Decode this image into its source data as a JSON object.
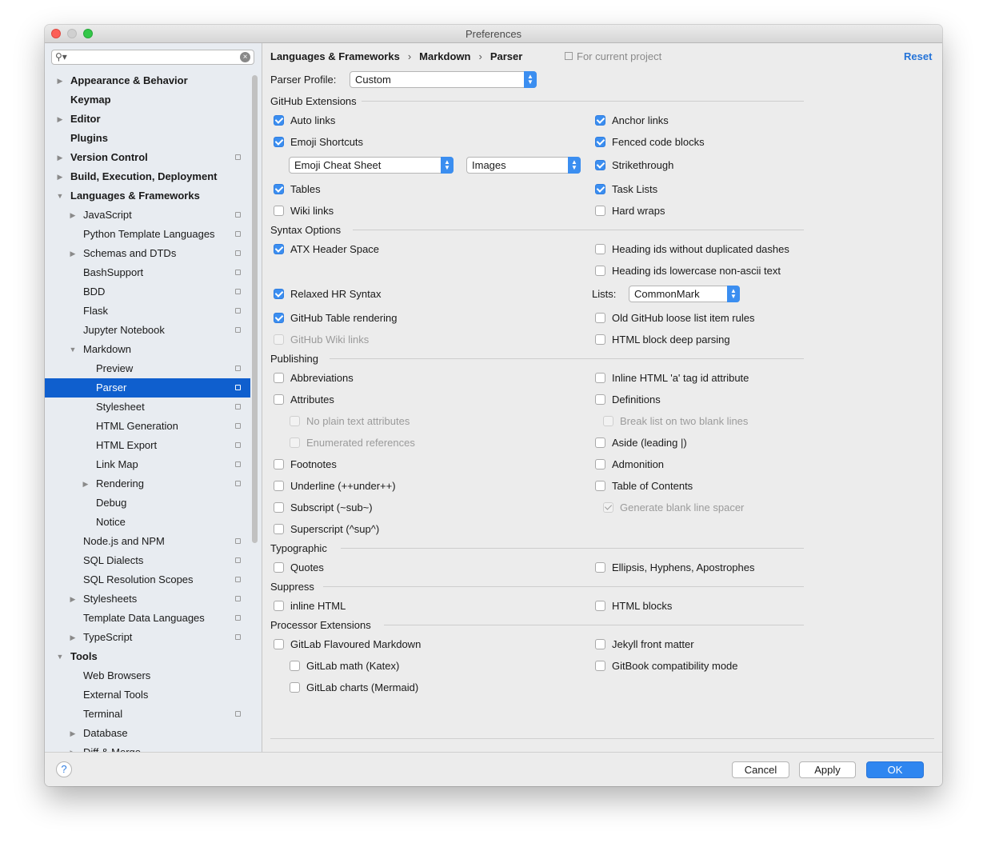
{
  "window": {
    "title": "Preferences"
  },
  "search": {
    "placeholder": ""
  },
  "sidebar": {
    "items": [
      {
        "label": "Appearance & Behavior",
        "level": 0,
        "bold": true,
        "arrow": "right",
        "copy": false
      },
      {
        "label": "Keymap",
        "level": 0,
        "bold": true,
        "arrow": "",
        "copy": false
      },
      {
        "label": "Editor",
        "level": 0,
        "bold": true,
        "arrow": "right",
        "copy": false
      },
      {
        "label": "Plugins",
        "level": 0,
        "bold": true,
        "arrow": "",
        "copy": false
      },
      {
        "label": "Version Control",
        "level": 0,
        "bold": true,
        "arrow": "right",
        "copy": true
      },
      {
        "label": "Build, Execution, Deployment",
        "level": 0,
        "bold": true,
        "arrow": "right",
        "copy": false
      },
      {
        "label": "Languages & Frameworks",
        "level": 0,
        "bold": true,
        "arrow": "down",
        "copy": false
      },
      {
        "label": "JavaScript",
        "level": 1,
        "arrow": "right",
        "copy": true
      },
      {
        "label": "Python Template Languages",
        "level": 1,
        "arrow": "",
        "copy": true
      },
      {
        "label": "Schemas and DTDs",
        "level": 1,
        "arrow": "right",
        "copy": true
      },
      {
        "label": "BashSupport",
        "level": 1,
        "arrow": "",
        "copy": true
      },
      {
        "label": "BDD",
        "level": 1,
        "arrow": "",
        "copy": true
      },
      {
        "label": "Flask",
        "level": 1,
        "arrow": "",
        "copy": true
      },
      {
        "label": "Jupyter Notebook",
        "level": 1,
        "arrow": "",
        "copy": true
      },
      {
        "label": "Markdown",
        "level": 1,
        "arrow": "down",
        "copy": false
      },
      {
        "label": "Preview",
        "level": 2,
        "arrow": "",
        "copy": true
      },
      {
        "label": "Parser",
        "level": 2,
        "arrow": "",
        "copy": true,
        "selected": true
      },
      {
        "label": "Stylesheet",
        "level": 2,
        "arrow": "",
        "copy": true
      },
      {
        "label": "HTML Generation",
        "level": 2,
        "arrow": "",
        "copy": true
      },
      {
        "label": "HTML Export",
        "level": 2,
        "arrow": "",
        "copy": true
      },
      {
        "label": "Link Map",
        "level": 2,
        "arrow": "",
        "copy": true
      },
      {
        "label": "Rendering",
        "level": 2,
        "arrow": "right",
        "copy": true
      },
      {
        "label": "Debug",
        "level": 2,
        "arrow": "",
        "copy": false
      },
      {
        "label": "Notice",
        "level": 2,
        "arrow": "",
        "copy": false
      },
      {
        "label": "Node.js and NPM",
        "level": 1,
        "arrow": "",
        "copy": true
      },
      {
        "label": "SQL Dialects",
        "level": 1,
        "arrow": "",
        "copy": true
      },
      {
        "label": "SQL Resolution Scopes",
        "level": 1,
        "arrow": "",
        "copy": true
      },
      {
        "label": "Stylesheets",
        "level": 1,
        "arrow": "right",
        "copy": true
      },
      {
        "label": "Template Data Languages",
        "level": 1,
        "arrow": "",
        "copy": true
      },
      {
        "label": "TypeScript",
        "level": 1,
        "arrow": "right",
        "copy": true
      },
      {
        "label": "Tools",
        "level": 0,
        "bold": true,
        "arrow": "down",
        "copy": false
      },
      {
        "label": "Web Browsers",
        "level": 1,
        "arrow": "",
        "copy": false
      },
      {
        "label": "External Tools",
        "level": 1,
        "arrow": "",
        "copy": false
      },
      {
        "label": "Terminal",
        "level": 1,
        "arrow": "",
        "copy": true
      },
      {
        "label": "Database",
        "level": 1,
        "arrow": "right",
        "copy": false
      },
      {
        "label": "Diff & Merge",
        "level": 1,
        "arrow": "right",
        "copy": false
      }
    ]
  },
  "header": {
    "breadcrumb": [
      "Languages & Frameworks",
      "Markdown",
      "Parser"
    ],
    "for_project": "For current project",
    "reset": "Reset"
  },
  "parser_profile": {
    "label": "Parser Profile:",
    "value": "Custom"
  },
  "sections": {
    "github_extensions": "GitHub Extensions",
    "syntax_options": "Syntax Options",
    "publishing": "Publishing",
    "typographic": "Typographic",
    "suppress": "Suppress",
    "processor_extensions": "Processor Extensions"
  },
  "combos": {
    "emoji_cheat_sheet": "Emoji Cheat Sheet",
    "images": "Images",
    "lists_label": "Lists:",
    "lists_value": "CommonMark"
  },
  "checkboxes": {
    "auto_links": {
      "label": "Auto links",
      "checked": true
    },
    "anchor_links": {
      "label": "Anchor links",
      "checked": true
    },
    "emoji_shortcuts": {
      "label": "Emoji Shortcuts",
      "checked": true
    },
    "fenced_code_blocks": {
      "label": "Fenced code blocks",
      "checked": true
    },
    "strikethrough": {
      "label": "Strikethrough",
      "checked": true
    },
    "tables": {
      "label": "Tables",
      "checked": true
    },
    "task_lists": {
      "label": "Task Lists",
      "checked": true
    },
    "wiki_links": {
      "label": "Wiki links",
      "checked": false
    },
    "hard_wraps": {
      "label": "Hard wraps",
      "checked": false
    },
    "atx_header_space": {
      "label": "ATX Header Space",
      "checked": true
    },
    "heading_ids_no_dup_dashes": {
      "label": "Heading ids without duplicated dashes",
      "checked": false
    },
    "heading_ids_lowercase": {
      "label": "Heading ids lowercase non-ascii text",
      "checked": false
    },
    "relaxed_hr_syntax": {
      "label": "Relaxed HR Syntax",
      "checked": true
    },
    "github_table_rendering": {
      "label": "GitHub Table rendering",
      "checked": true
    },
    "old_github_loose_list": {
      "label": "Old GitHub loose list item rules",
      "checked": false
    },
    "github_wiki_links": {
      "label": "GitHub Wiki links",
      "checked": false,
      "disabled": true
    },
    "html_block_deep_parsing": {
      "label": "HTML block deep parsing",
      "checked": false
    },
    "abbreviations": {
      "label": "Abbreviations",
      "checked": false
    },
    "inline_html_a_tag": {
      "label": "Inline HTML 'a' tag id attribute",
      "checked": false
    },
    "attributes": {
      "label": "Attributes",
      "checked": false
    },
    "definitions": {
      "label": "Definitions",
      "checked": false
    },
    "no_plain_text_attributes": {
      "label": "No plain text attributes",
      "checked": false,
      "disabled": true
    },
    "break_list_two_blank": {
      "label": "Break list on two blank lines",
      "checked": false,
      "disabled": true
    },
    "enumerated_references": {
      "label": "Enumerated references",
      "checked": false,
      "disabled": true
    },
    "aside_leading": {
      "label": "Aside (leading |)",
      "checked": false
    },
    "footnotes": {
      "label": "Footnotes",
      "checked": false
    },
    "admonition": {
      "label": "Admonition",
      "checked": false
    },
    "underline": {
      "label": "Underline (++under++)",
      "checked": false
    },
    "table_of_contents": {
      "label": "Table of Contents",
      "checked": false
    },
    "subscript": {
      "label": "Subscript (~sub~)",
      "checked": false
    },
    "generate_blank_line_spacer": {
      "label": "Generate blank line spacer",
      "checked": true,
      "disabled": true
    },
    "superscript": {
      "label": "Superscript (^sup^)",
      "checked": false
    },
    "quotes": {
      "label": "Quotes",
      "checked": false
    },
    "ellipsis_hyphens": {
      "label": "Ellipsis, Hyphens, Apostrophes",
      "checked": false
    },
    "inline_html": {
      "label": "inline HTML",
      "checked": false
    },
    "html_blocks": {
      "label": "HTML blocks",
      "checked": false
    },
    "gitlab_flavoured": {
      "label": "GitLab Flavoured Markdown",
      "checked": false
    },
    "jekyll_front_matter": {
      "label": "Jekyll front matter",
      "checked": false
    },
    "gitlab_math": {
      "label": "GitLab math (Katex)",
      "checked": false
    },
    "gitbook_compat": {
      "label": "GitBook compatibility mode",
      "checked": false
    },
    "gitlab_charts": {
      "label": "GitLab charts (Mermaid)",
      "checked": false
    }
  },
  "footer": {
    "help": "?",
    "cancel": "Cancel",
    "apply": "Apply",
    "ok": "OK"
  },
  "colors": {
    "accent": "#3b8ef0",
    "selection": "#0f5fce",
    "link": "#2473d8"
  }
}
